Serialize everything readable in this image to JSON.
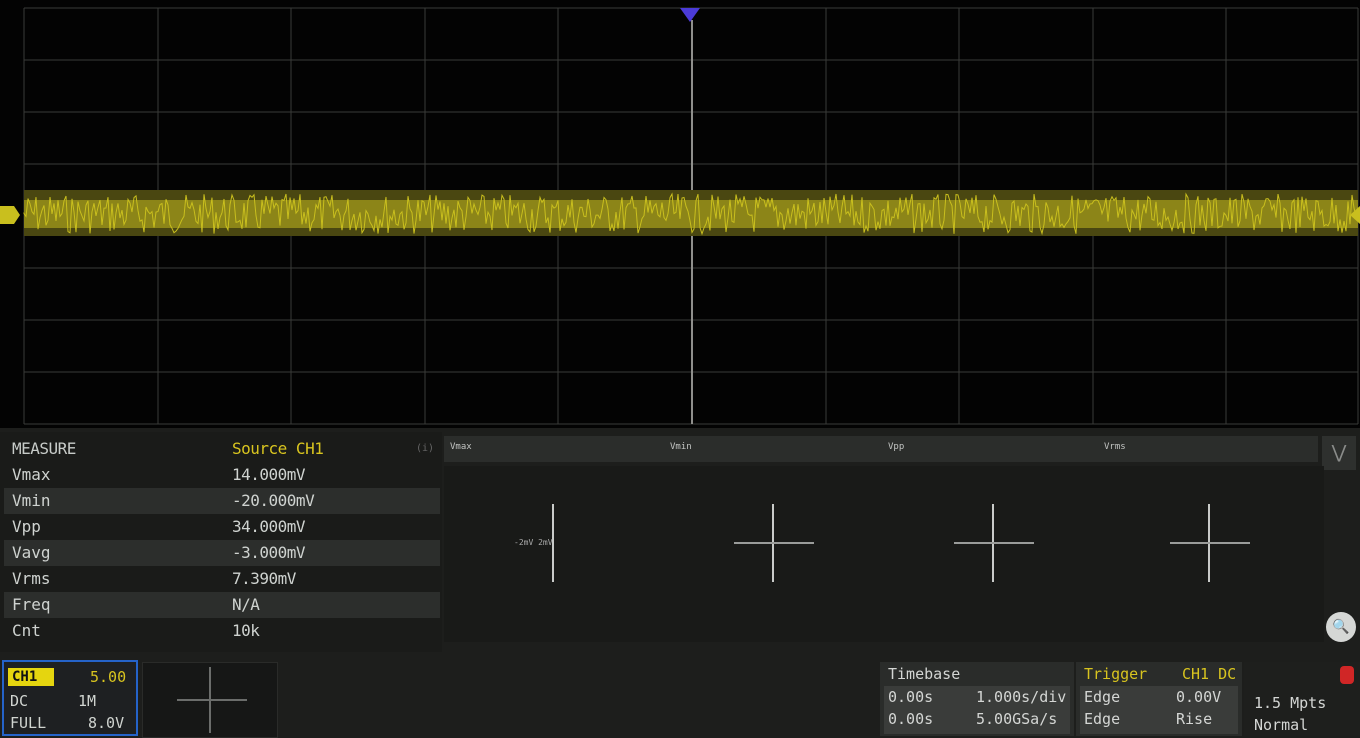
{
  "app": {
    "trace_color": "#c9bf1e",
    "trigger_marker_color": "#4b3bd8",
    "selected_border_color": "#2563c9"
  },
  "measurements": {
    "header_label": "MEASURE",
    "header_value": "Source CH1",
    "header_tag": "(i)",
    "rows": [
      {
        "label": "Vmax",
        "value": "14.000mV"
      },
      {
        "label": "Vmin",
        "value": "-20.000mV"
      },
      {
        "label": "Vpp",
        "value": "34.000mV"
      },
      {
        "label": "Vavg",
        "value": "-3.000mV"
      },
      {
        "label": "Vrms",
        "value": "7.390mV"
      },
      {
        "label": "Freq",
        "value": "N/A"
      },
      {
        "label": "Cnt",
        "value": "10k"
      }
    ]
  },
  "tabs": [
    "Vmax",
    "Vmin",
    "Vpp",
    "Vrms"
  ],
  "plots": [
    {
      "label": "-2mV    2mV"
    },
    {
      "label": ""
    },
    {
      "label": ""
    },
    {
      "label": ""
    }
  ],
  "zoom_icon": "magnifier-icon",
  "channel": {
    "tag": "CH1",
    "scale": "5.00",
    "row1_left": "DC",
    "row1_right": "1M",
    "row2_left": "FULL",
    "row2_right": "8.0V"
  },
  "timebase": {
    "title": "Timebase",
    "row1_left": "0.00s",
    "row1_right": "1.000s/div",
    "row2_left": "0.00s",
    "row2_right": "5.00GSa/s"
  },
  "trigger": {
    "title": "Trigger",
    "level": "CH1 DC",
    "row1_left": "Edge",
    "row1_right": "0.00V",
    "row2_left": "Edge",
    "row2_right": "Rise"
  },
  "acquire": {
    "row1": "1.5 Mpts",
    "row2": "Normal"
  }
}
